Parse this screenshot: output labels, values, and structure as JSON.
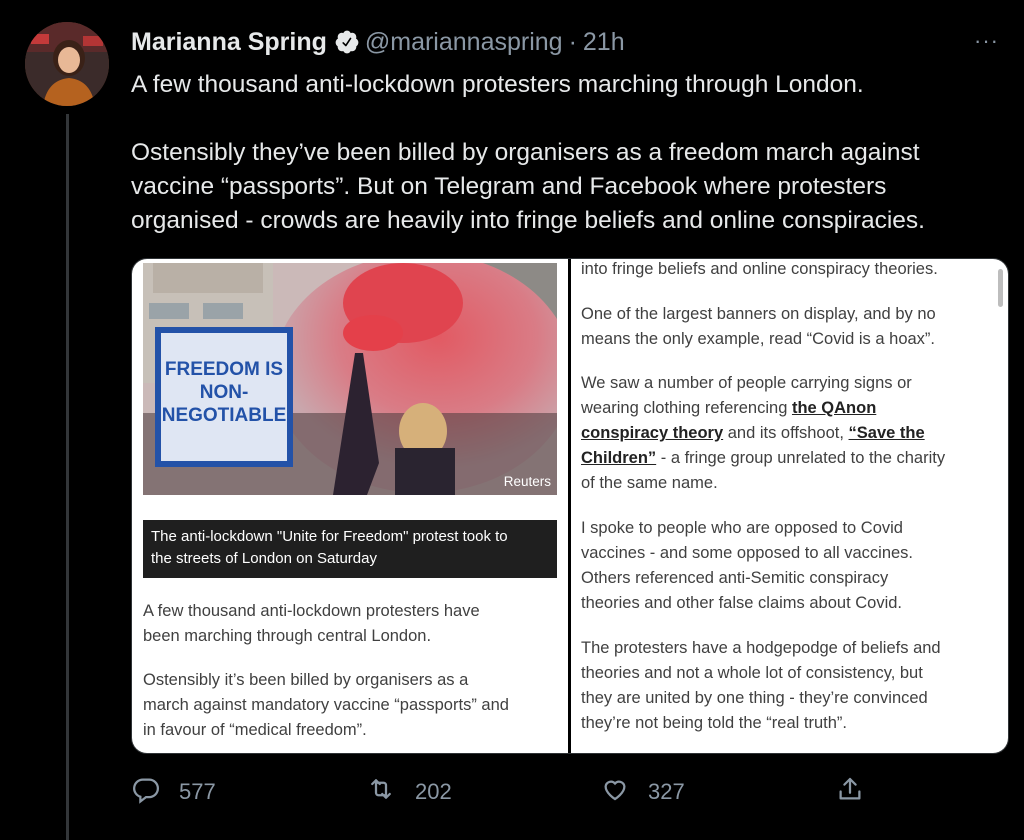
{
  "tweet": {
    "author_name": "Marianna Spring",
    "handle": "@mariannaspring",
    "separator": "·",
    "time": "21h",
    "more_label": "···",
    "lines": [
      "A few thousand anti-lockdown protesters marching through London.",
      "",
      "Ostensibly they’ve been billed by organisers as a freedom march against",
      "vaccine “passports”. But on Telegram and Facebook where protesters",
      "organised - crowds are heavily into fringe beliefs and online conspiracies."
    ]
  },
  "media": {
    "left": {
      "sign_text": [
        "FREEDOM IS",
        "NON-",
        "NEGOTIABLE"
      ],
      "photo_credit": "Reuters",
      "caption": [
        "The anti-lockdown \"Unite for Freedom\" protest took to",
        "the streets of London on Saturday"
      ],
      "paragraphs": [
        [
          "A few thousand anti-lockdown protesters have",
          "been marching through central London."
        ],
        [
          "Ostensibly it’s been billed by organisers as a",
          "march against mandatory vaccine “passports” and",
          "in favour of “medical freedom”."
        ]
      ]
    },
    "right": {
      "p0": "into fringe beliefs and online conspiracy theories.",
      "p1": [
        "One of the largest banners on display, and by no",
        "means the only example, read “Covid is a hoax”."
      ],
      "p2_l1": "We saw a number of people carrying signs or",
      "p2_l2_pre": "wearing clothing referencing ",
      "p2_link1_a": "the QAnon",
      "p2_link1_b": "conspiracy theory",
      "p2_l3_mid": " and its offshoot, ",
      "p2_link2_a": "“Save the",
      "p2_link2_b": "Children”",
      "p2_l4_post": " - a fringe group unrelated to the charity",
      "p2_l5": "of the same name.",
      "p3": [
        "I spoke to people who are opposed to Covid",
        "vaccines - and some opposed to all vaccines.",
        "Others referenced anti-Semitic conspiracy",
        "theories and other false claims about Covid."
      ],
      "p4": [
        "The protesters have a hodgepodge of beliefs and",
        "theories and not a whole lot of consistency, but",
        "they are united by one thing - they’re convinced",
        "they’re not being told the “real truth”."
      ]
    }
  },
  "actions": {
    "replies": "577",
    "retweets": "202",
    "likes": "327",
    "icons": [
      "reply-icon",
      "retweet-icon",
      "like-icon",
      "share-icon"
    ]
  },
  "colors": {
    "background": "#000000",
    "text": "#e7e9ea",
    "muted": "#8b98a5",
    "verified": "#e7e9ea"
  }
}
